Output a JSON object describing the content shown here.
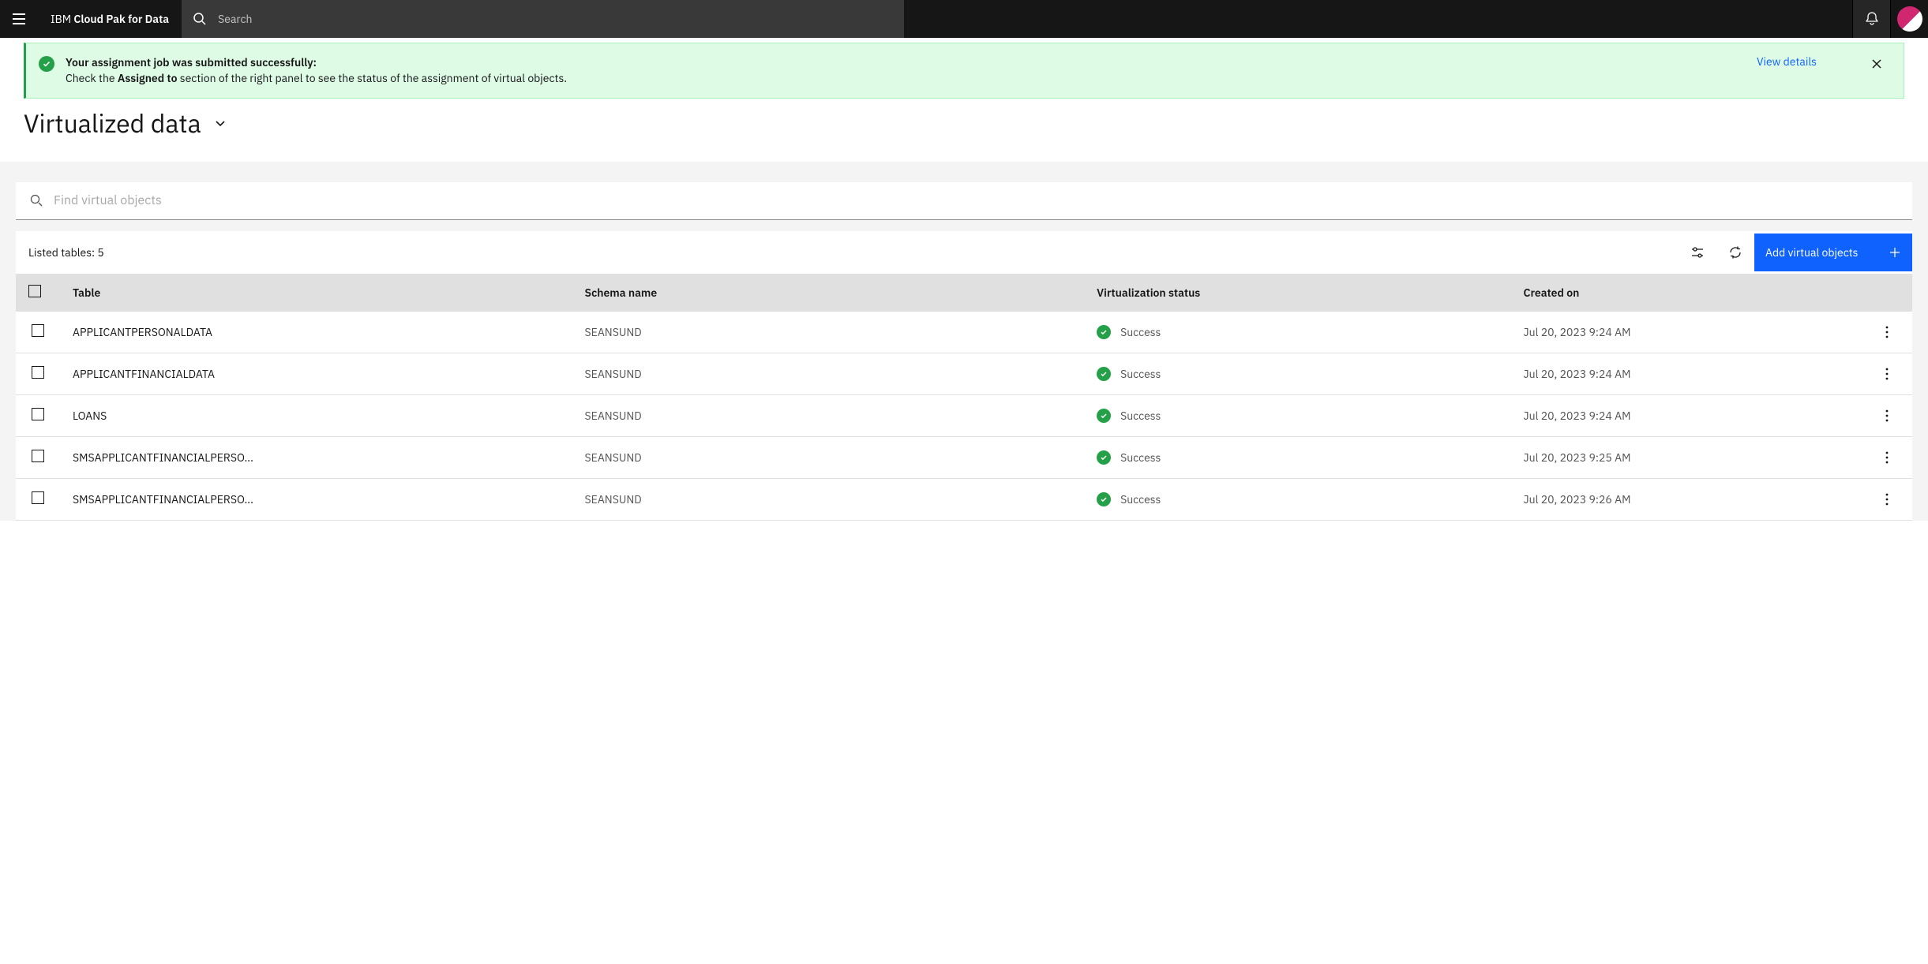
{
  "header": {
    "brand_prefix": "IBM ",
    "brand_name": "Cloud Pak for Data",
    "search_placeholder": "Search"
  },
  "notification": {
    "title": "Your assignment job was submitted successfully:",
    "msg_prefix": "Check the ",
    "msg_bold": "Assigned to",
    "msg_suffix": " section of the right panel to see the status of the assignment of virtual objects.",
    "link_label": "View details"
  },
  "page": {
    "title": "Virtualized data"
  },
  "filter": {
    "placeholder": "Find virtual objects"
  },
  "toolbar": {
    "listed_label": "Listed tables: 5",
    "add_label": "Add virtual objects"
  },
  "table": {
    "headers": {
      "table": "Table",
      "schema": "Schema name",
      "status": "Virtualization status",
      "created": "Created on"
    },
    "rows": [
      {
        "table": "APPLICANTPERSONALDATA",
        "schema": "SEANSUND",
        "status": "Success",
        "created": "Jul 20, 2023 9:24 AM"
      },
      {
        "table": "APPLICANTFINANCIALDATA",
        "schema": "SEANSUND",
        "status": "Success",
        "created": "Jul 20, 2023 9:24 AM"
      },
      {
        "table": "LOANS",
        "schema": "SEANSUND",
        "status": "Success",
        "created": "Jul 20, 2023 9:24 AM"
      },
      {
        "table": "SMSAPPLICANTFINANCIALPERSO...",
        "schema": "SEANSUND",
        "status": "Success",
        "created": "Jul 20, 2023 9:25 AM"
      },
      {
        "table": "SMSAPPLICANTFINANCIALPERSO...",
        "schema": "SEANSUND",
        "status": "Success",
        "created": "Jul 20, 2023 9:26 AM"
      }
    ]
  }
}
